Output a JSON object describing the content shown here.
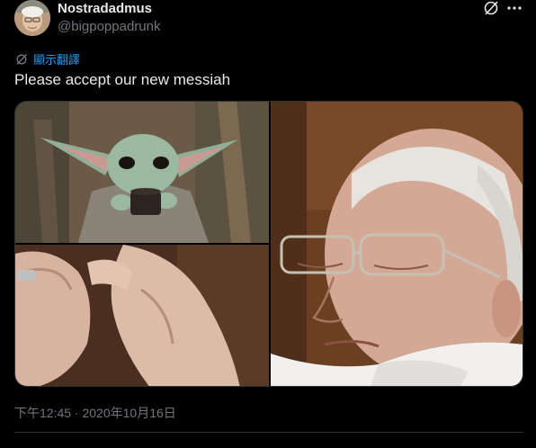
{
  "user": {
    "display_name": "Nostradadmus",
    "handle": "@bigpoppadrunk"
  },
  "translate_label": "顯示翻譯",
  "tweet_text": "Please accept our new messiah",
  "media": {
    "layout": "2x2 grid with merged right column",
    "items": [
      {
        "position": "top-left",
        "alt": ""
      },
      {
        "position": "bottom-left",
        "alt": ""
      },
      {
        "position": "right",
        "alt": ""
      }
    ]
  },
  "timestamp": "下午12:45 · 2020年10月16日",
  "icons": {
    "grok": "grok-icon",
    "more": "more-options-icon",
    "translate": "translate-icon"
  },
  "colors": {
    "background": "#000000",
    "primary_text": "#e7e9ea",
    "secondary_text": "#71767b",
    "link": "#1d9bf0",
    "border": "#2f3336"
  }
}
